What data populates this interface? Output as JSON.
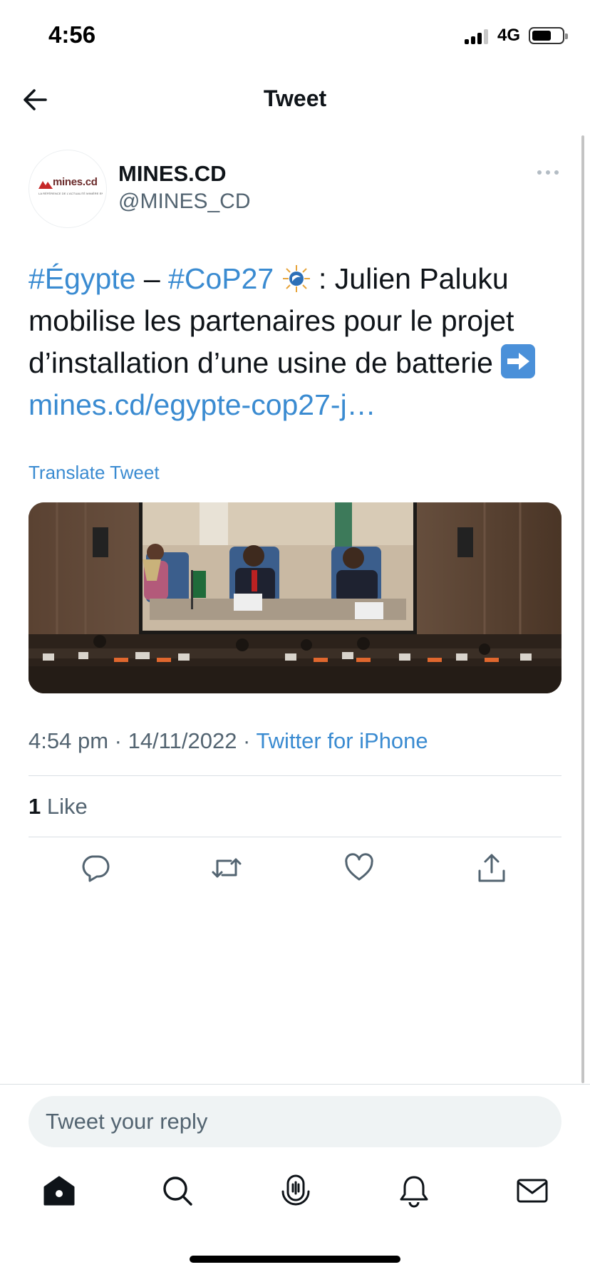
{
  "status_bar": {
    "time": "4:56",
    "network": "4G"
  },
  "header": {
    "title": "Tweet"
  },
  "author": {
    "avatar_logo_text": "mines.cd",
    "avatar_logo_subtitle": "LA RÉFÉRENCE DE L'ACTUALITÉ MINIÈRE EN RDC",
    "name": "MINES.CD",
    "handle": "@MINES_CD"
  },
  "tweet": {
    "hashtag1": "#Égypte",
    "dash": " – ",
    "hashtag2": "#CoP27",
    "text_after_emoji": " : Julien Paluku mobilise les partenaires pour le projet d’installation d’une usine de batterie ",
    "link": "mines.cd/egypte-cop27-j…",
    "translate_label": "Translate Tweet",
    "time": "4:54 pm",
    "date": "14/11/2022",
    "separator": " · ",
    "source": "Twitter for iPhone",
    "like_count": "1",
    "like_label": " Like"
  },
  "reply": {
    "placeholder": "Tweet your reply"
  },
  "colors": {
    "link": "#3a8bd1",
    "text": "#0f1419",
    "secondary": "#536471",
    "divider": "#d9dfe3"
  },
  "icons": {
    "header": "back-arrow-icon",
    "actions": [
      "reply-icon",
      "retweet-icon",
      "like-icon",
      "share-icon"
    ],
    "tabbar": [
      "home-icon",
      "search-icon",
      "spaces-icon",
      "notifications-icon",
      "messages-icon"
    ]
  }
}
